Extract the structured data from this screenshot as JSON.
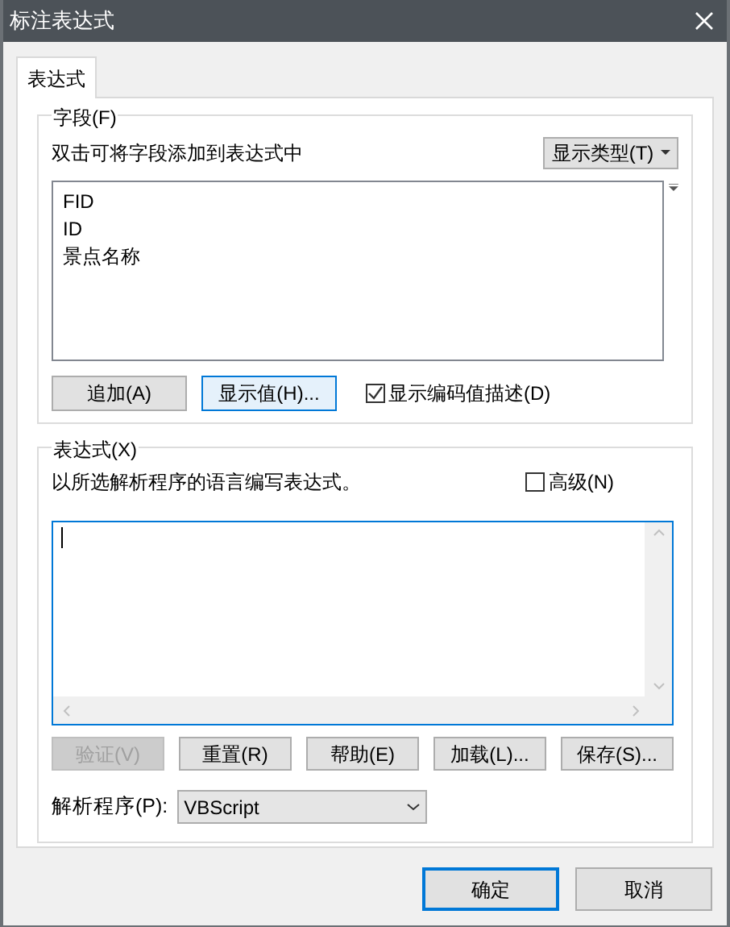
{
  "window": {
    "title": "标注表达式"
  },
  "tabs": [
    {
      "label": "表达式",
      "selected": true
    }
  ],
  "fields_group": {
    "title": "字段(F)",
    "hint": "双击可将字段添加到表达式中",
    "show_type_button": "显示类型(T)",
    "fields": [
      "FID",
      "ID",
      "景点名称"
    ],
    "buttons": [
      {
        "label": "追加(A)",
        "focused": false
      },
      {
        "label": "显示值(H)...",
        "focused": true
      }
    ],
    "show_coded_descriptions": {
      "label": "显示编码值描述(D)",
      "checked": true
    }
  },
  "expression_group": {
    "title": "表达式(X)",
    "hint": "以所选解析程序的语言编写表达式。",
    "advanced": {
      "label": "高级(N)",
      "checked": false
    },
    "buttons": [
      {
        "label": "验证(V)",
        "disabled": true
      },
      {
        "label": "重置(R)",
        "disabled": false
      },
      {
        "label": "帮助(E)",
        "disabled": false
      },
      {
        "label": "加载(L)...",
        "disabled": false
      },
      {
        "label": "保存(S)...",
        "disabled": false
      }
    ],
    "parser_label": "解析程序(P):",
    "parser": "VBScript"
  },
  "buttons": [
    {
      "label": "确定",
      "default": true
    },
    {
      "label": "取消",
      "default": false
    }
  ]
}
